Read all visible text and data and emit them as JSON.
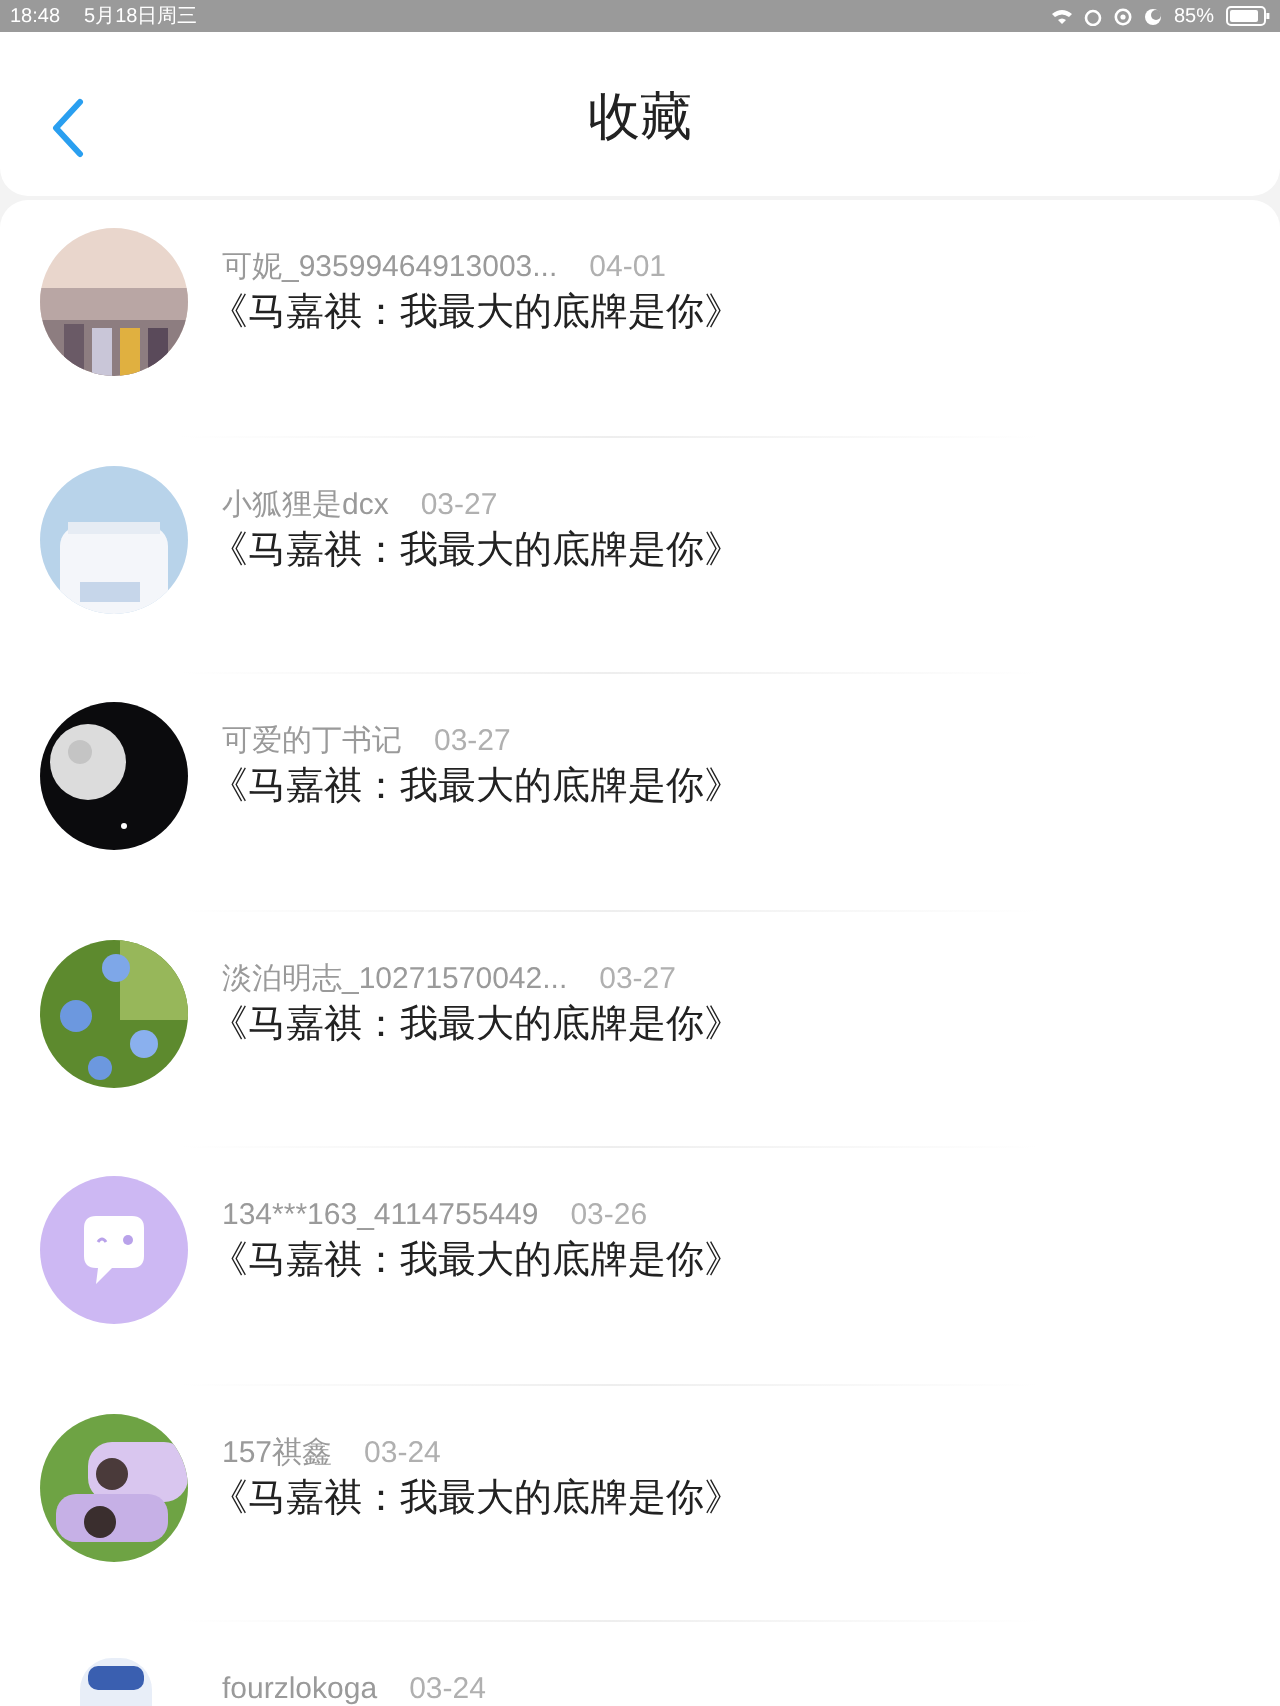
{
  "status_bar": {
    "time": "18:48",
    "date": "5月18日周三",
    "battery": "85%"
  },
  "header": {
    "title": "收藏"
  },
  "items": [
    {
      "name": "可妮_93599464913003...",
      "date": "04-01",
      "title": "《马嘉祺：我最大的底牌是你》"
    },
    {
      "name": "小狐狸是dcx",
      "date": "03-27",
      "title": "《马嘉祺：我最大的底牌是你》"
    },
    {
      "name": "可爱的丁书记",
      "date": "03-27",
      "title": "《马嘉祺：我最大的底牌是你》"
    },
    {
      "name": "淡泊明志_10271570042...",
      "date": "03-27",
      "title": "《马嘉祺：我最大的底牌是你》"
    },
    {
      "name": "134***163_4114755449",
      "date": "03-26",
      "title": "《马嘉祺：我最大的底牌是你》",
      "avatar": {
        "kind": "default"
      }
    },
    {
      "name": "157祺鑫",
      "date": "03-24",
      "title": "《马嘉祺：我最大的底牌是你》"
    },
    {
      "name": "fourzlokoga",
      "date": "03-24"
    }
  ]
}
